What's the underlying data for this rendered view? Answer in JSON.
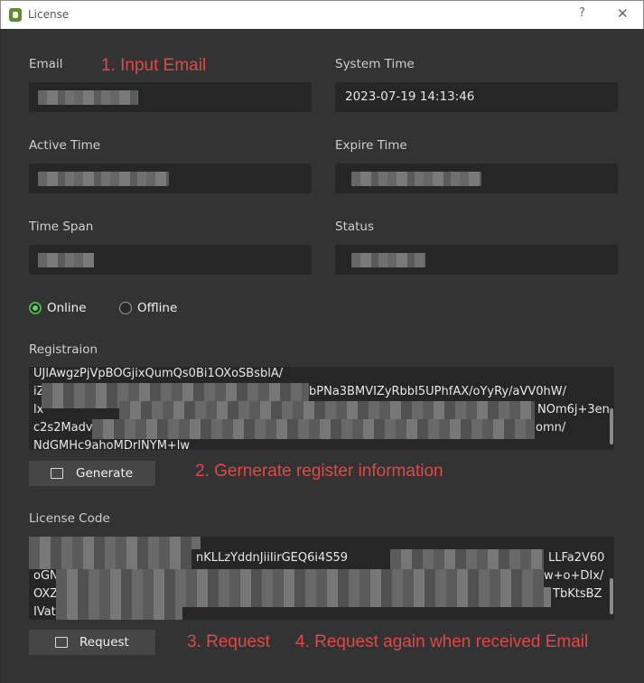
{
  "window": {
    "title": "License",
    "help_glyph": "?",
    "close_glyph": "✕"
  },
  "form": {
    "email_label": "Email",
    "system_time_label": "System Time",
    "system_time_value": "2023-07-19 14:13:46",
    "active_time_label": "Active Time",
    "expire_time_label": "Expire Time",
    "time_span_label": "Time Span",
    "status_label": "Status"
  },
  "mode": {
    "online_label": "Online",
    "offline_label": "Offline",
    "selected": "Online"
  },
  "registration": {
    "label": "Registraion",
    "lines": [
      "UJlAwgzPjVpBOGjixQumQs0Bi1OXoSBsblA/",
      "iZ",
      "lx",
      "c2s2Madvothp",
      "NdGMHc9ahoMDrINYM+lw"
    ],
    "line2_tail": "bPNa3BMVIZyRbbI5UPhfAX/oYyRy/aVV0hW/",
    "line3_tail": "NOm6j+3en",
    "line4_tail": "omn/"
  },
  "generate_button": {
    "label": "Generate"
  },
  "license": {
    "label": "License Code",
    "lines": [
      "",
      "oGN",
      "OXZ",
      "IVat"
    ],
    "line1_mid": "nKLLzYddnJiiIirGEQ6i4S59",
    "line1_tail": "LLFa2V60",
    "line2_tail": "w+o+DIx/",
    "line3_tail": "TbKtsBZ"
  },
  "request_button": {
    "label": "Request"
  },
  "annotations": {
    "step1": "1. Input Email",
    "step2": "2. Gernerate register information",
    "step3": "3. Request",
    "step4": "4. Request again when received Email",
    "color": "#e04848"
  },
  "colors": {
    "background": "#333333",
    "field": "#262626",
    "button": "#464646",
    "radio_accent": "#47b347"
  },
  "icons": {
    "app": "app-logo-icon",
    "generate": "generate-icon",
    "request": "message-icon"
  }
}
